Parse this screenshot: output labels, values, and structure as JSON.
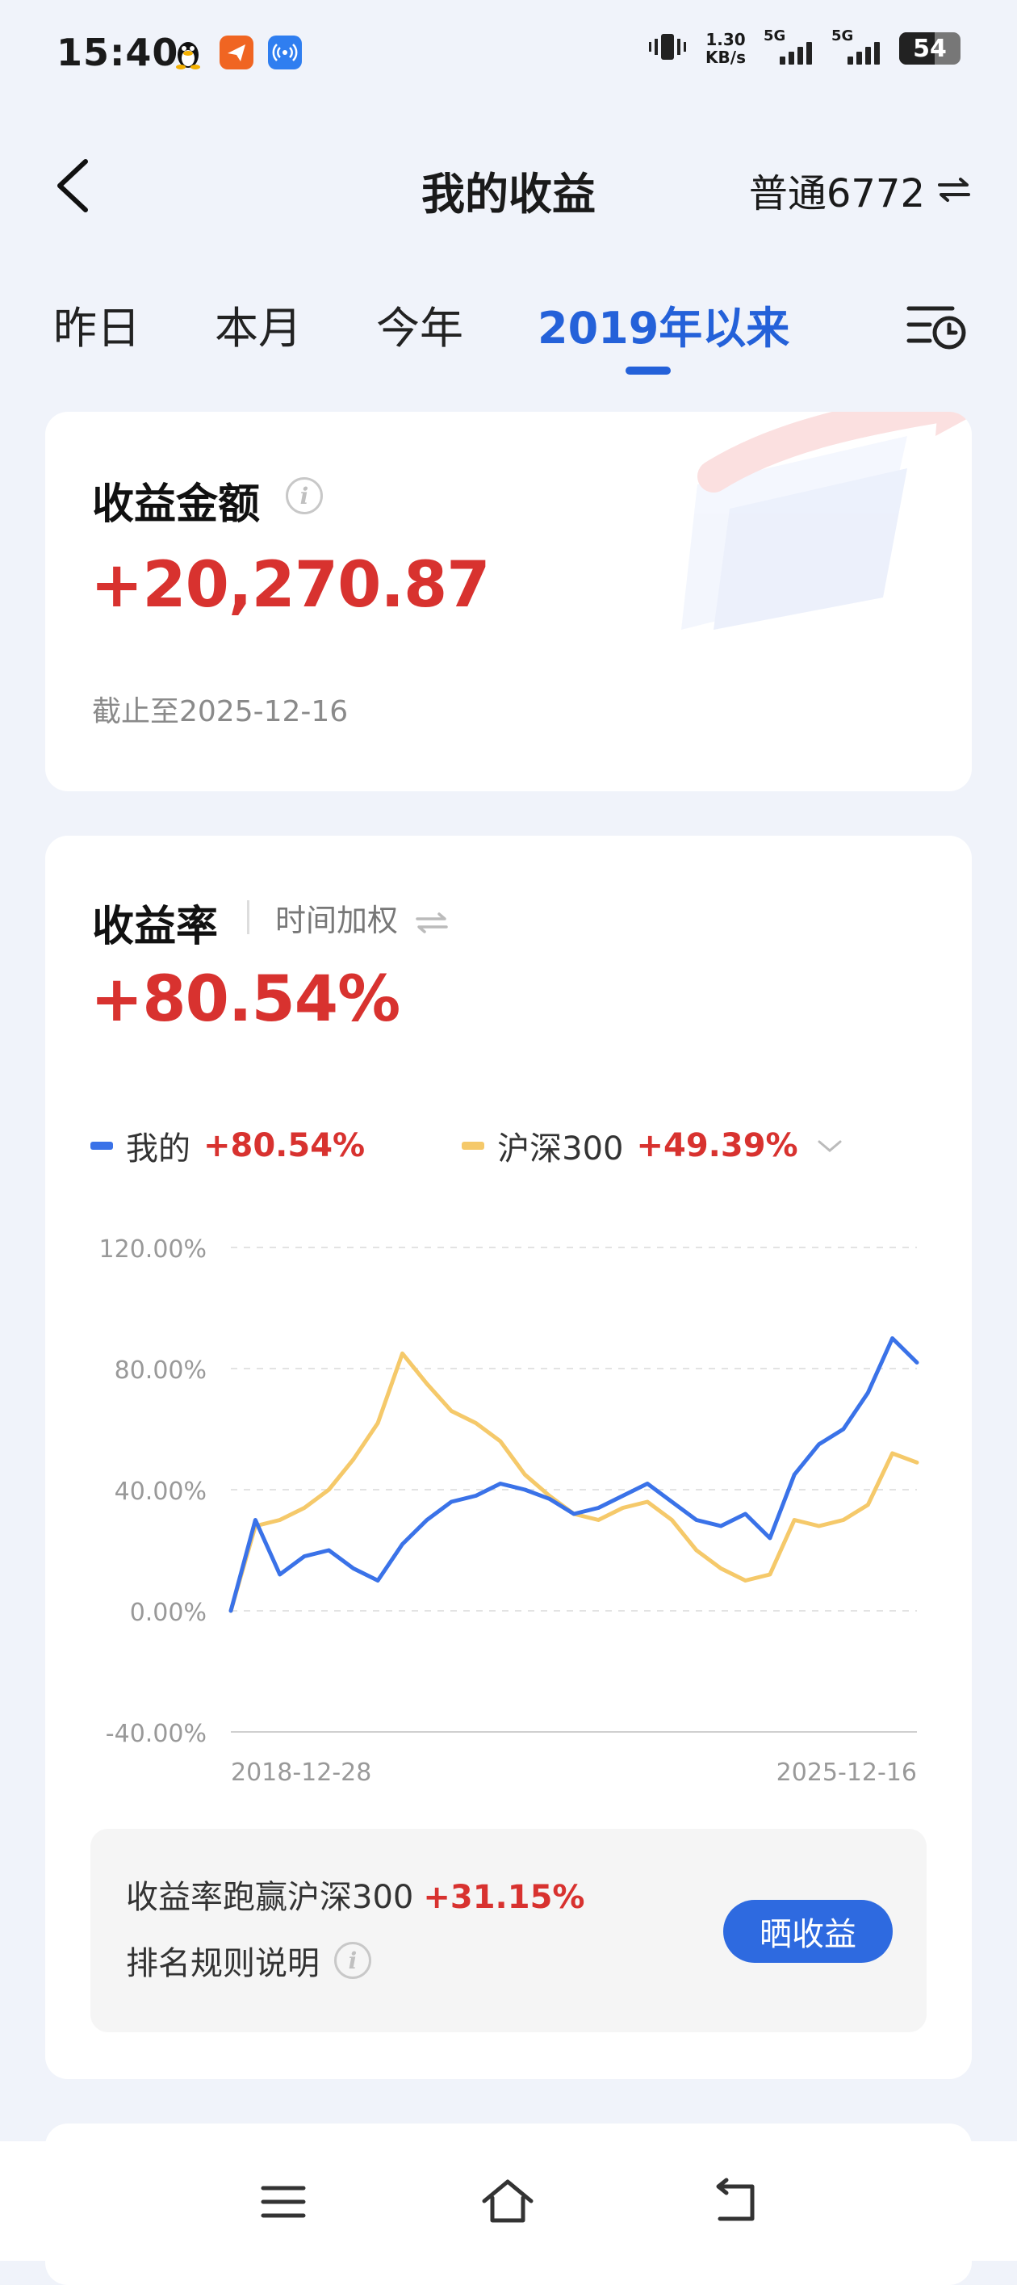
{
  "status_bar": {
    "time": "15:40",
    "net_speed": "1.30",
    "net_unit": "KB/s",
    "signal1_label": "5G",
    "signal2_label": "5G",
    "battery": "54",
    "app_icons": [
      "qq-penguin-icon",
      "send-arrow-icon",
      "broadcast-icon"
    ]
  },
  "header": {
    "back_icon": "chevron-left-icon",
    "title": "我的收益",
    "account": "普通6772",
    "swap_icon": "swap-arrows-icon"
  },
  "tabs": [
    {
      "label": "昨日",
      "active": false
    },
    {
      "label": "本月",
      "active": false
    },
    {
      "label": "今年",
      "active": false
    },
    {
      "label": "2019年以来",
      "active": true
    }
  ],
  "history_icon": "list-clock-icon",
  "profit_card": {
    "title": "收益金额",
    "amount": "+20,270.87",
    "as_of": "截止至2025-12-16"
  },
  "return_card": {
    "title": "收益率",
    "method": "时间加权",
    "rate": "+80.54%",
    "legend": [
      {
        "name": "我的",
        "value": "+80.54%",
        "color": "#3a72e8"
      },
      {
        "name": "沪深300",
        "value": "+49.39%",
        "color": "#f5c96a"
      }
    ],
    "summary_text": "收益率跑赢沪深300",
    "summary_value": "+31.15%",
    "rules_text": "排名规则说明",
    "share_button": "晒收益"
  },
  "chart_data": {
    "type": "line",
    "x_start": "2018-12-28",
    "x_end": "2025-12-16",
    "yticks": [
      "120.00%",
      "80.00%",
      "40.00%",
      "0.00%",
      "-40.00%"
    ],
    "ylim": [
      -40,
      120
    ],
    "grid": true,
    "x": [
      "2018-12",
      "2019-03",
      "2019-06",
      "2019-09",
      "2019-12",
      "2020-03",
      "2020-06",
      "2020-09",
      "2020-12",
      "2021-03",
      "2021-06",
      "2021-09",
      "2021-12",
      "2022-03",
      "2022-06",
      "2022-09",
      "2022-12",
      "2023-03",
      "2023-06",
      "2023-09",
      "2023-12",
      "2024-03",
      "2024-06",
      "2024-09",
      "2024-12",
      "2025-03",
      "2025-06",
      "2025-09",
      "2025-12"
    ],
    "series": [
      {
        "name": "我的",
        "color": "#3a72e8",
        "values": [
          0,
          30,
          12,
          18,
          20,
          14,
          10,
          22,
          30,
          36,
          38,
          42,
          40,
          37,
          32,
          34,
          38,
          42,
          36,
          30,
          28,
          32,
          24,
          45,
          55,
          60,
          72,
          90,
          82
        ]
      },
      {
        "name": "沪深300",
        "color": "#f5c96a",
        "values": [
          0,
          28,
          30,
          34,
          40,
          50,
          62,
          85,
          75,
          66,
          62,
          56,
          45,
          38,
          32,
          30,
          34,
          36,
          30,
          20,
          14,
          10,
          12,
          30,
          28,
          30,
          35,
          52,
          49
        ]
      }
    ]
  }
}
